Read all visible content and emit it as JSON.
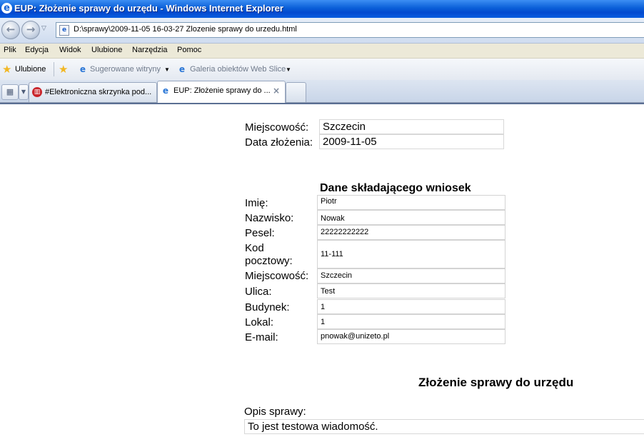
{
  "window": {
    "title": "EUP: Złożenie sprawy do urzędu - Windows Internet Explorer",
    "address": "D:\\sprawy\\2009-11-05 16-03-27 Zlozenie sprawy do urzedu.html"
  },
  "menu": [
    "Plik",
    "Edycja",
    "Widok",
    "Ulubione",
    "Narzędzia",
    "Pomoc"
  ],
  "favorites": {
    "label": "Ulubione",
    "suggested": "Sugerowane witryny",
    "webslice": "Galeria obiektów Web Slice"
  },
  "tabs": [
    {
      "label": "#Elektroniczna skrzynka pod..."
    },
    {
      "label": "EUP: Złożenie sprawy do ..."
    }
  ],
  "page": {
    "top_fields": [
      {
        "label": "Miejscowość:",
        "value": "Szczecin"
      },
      {
        "label": "Data złożenia:",
        "value": "2009-11-05"
      }
    ],
    "applicant_heading": "Dane składającego wniosek",
    "applicant_fields": [
      {
        "label": "Imię:",
        "value": "Piotr"
      },
      {
        "label": "Nazwisko:",
        "value": "Nowak"
      },
      {
        "label": "Pesel:",
        "value": "22222222222"
      },
      {
        "label": "Kod pocztowy:",
        "value": "11-111"
      },
      {
        "label": "Miejscowość:",
        "value": "Szczecin"
      },
      {
        "label": "Ulica:",
        "value": "Test"
      },
      {
        "label": "Budynek:",
        "value": "1"
      },
      {
        "label": "Lokal:",
        "value": "1"
      },
      {
        "label": "E-mail:",
        "value": "pnowak@unizeto.pl"
      }
    ],
    "case_heading": "Złożenie sprawy do urzędu",
    "description_label": "Opis sprawy:",
    "description_value": "To jest testowa wiadomość."
  }
}
